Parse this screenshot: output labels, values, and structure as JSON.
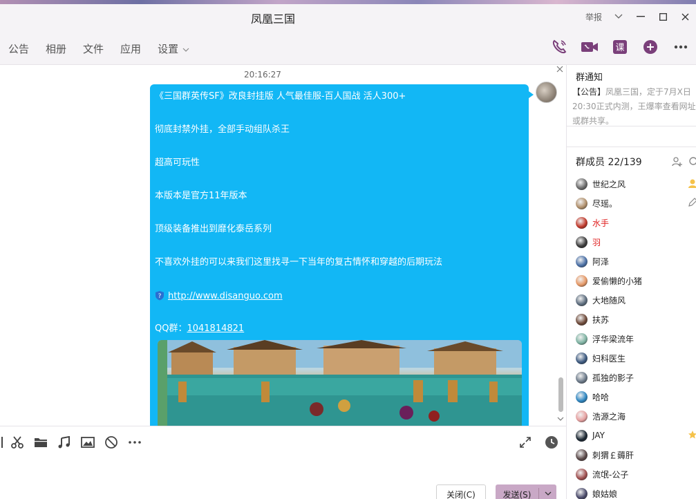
{
  "window": {
    "title": "凤凰三国",
    "report_label": "举报",
    "minimize_symbol": "—",
    "maximize_symbol": "☐",
    "close_symbol": "✕"
  },
  "nav": {
    "tabs": [
      "公告",
      "相册",
      "文件",
      "应用",
      "设置"
    ],
    "icons": [
      "phone-icon",
      "video-icon",
      "lesson-icon",
      "add-icon",
      "more-icon"
    ],
    "lesson_glyph": "课"
  },
  "chat": {
    "timestamp": "20:16:27",
    "message": {
      "line1": "《三国群英传SF》改良封挂版 人气最佳服-百人国战 活人300+",
      "line2": "彻底封禁外挂，全部手动组队杀王",
      "line3": "超高可玩性",
      "line4": "本版本是官方11年版本",
      "line5": "顶级装备推出到靡化泰岳系列",
      "line6": "不喜欢外挂的可以来我们这里找寻一下当年的复古情怀和穿越的后期玩法",
      "url": "http://www.disanguo.com",
      "qq_label": "QQ群：",
      "qq_number": "1041814821"
    }
  },
  "input": {
    "tools": [
      "scissors-icon",
      "folder-icon",
      "music-icon",
      "image-icon",
      "no-disturb-icon",
      "more-icon"
    ],
    "close_button": "关闭(C)",
    "send_button": "发送(S)"
  },
  "sidebar": {
    "notice_title": "群通知",
    "notice_tag": "【公告】",
    "notice_text": "凤凰三国，定于7月X日20:30正式内测，王爆率查看网址或群共享。",
    "members_title": "群成员 22/139",
    "members": [
      {
        "name": "世纪之风",
        "admin": false,
        "color": "#6b6b6b",
        "badge": "owner"
      },
      {
        "name": "尽瑶。",
        "admin": false,
        "color": "#b08f6b",
        "badge": "edit"
      },
      {
        "name": "水手",
        "admin": true,
        "color": "#c0392b",
        "badge": ""
      },
      {
        "name": "羽",
        "admin": true,
        "color": "#3b3b3b",
        "badge": ""
      },
      {
        "name": "阿泽",
        "admin": false,
        "color": "#4a6fa5",
        "badge": ""
      },
      {
        "name": "爱偷懒的小猪",
        "admin": false,
        "color": "#e59866",
        "badge": ""
      },
      {
        "name": "大地随风",
        "admin": false,
        "color": "#5d6d7e",
        "badge": ""
      },
      {
        "name": "扶苏",
        "admin": false,
        "color": "#6e4a3a",
        "badge": ""
      },
      {
        "name": "浮华梁流年",
        "admin": false,
        "color": "#7fb3a3",
        "badge": ""
      },
      {
        "name": "妇科医生",
        "admin": false,
        "color": "#3d5a80",
        "badge": ""
      },
      {
        "name": "孤独的影子",
        "admin": false,
        "color": "#6c7a89",
        "badge": ""
      },
      {
        "name": "哈哈",
        "admin": false,
        "color": "#2e86c1",
        "badge": ""
      },
      {
        "name": "浩源之海",
        "admin": false,
        "color": "#e6a0a0",
        "badge": ""
      },
      {
        "name": "JAY",
        "admin": false,
        "color": "#1c2833",
        "badge": "star"
      },
      {
        "name": "刺猬￡薅肝",
        "admin": false,
        "color": "#5b4a4a",
        "badge": ""
      },
      {
        "name": "流氓-公子",
        "admin": false,
        "color": "#a05050",
        "badge": ""
      },
      {
        "name": "娘姑娘",
        "admin": false,
        "color": "#4a4a6a",
        "badge": ""
      }
    ]
  }
}
